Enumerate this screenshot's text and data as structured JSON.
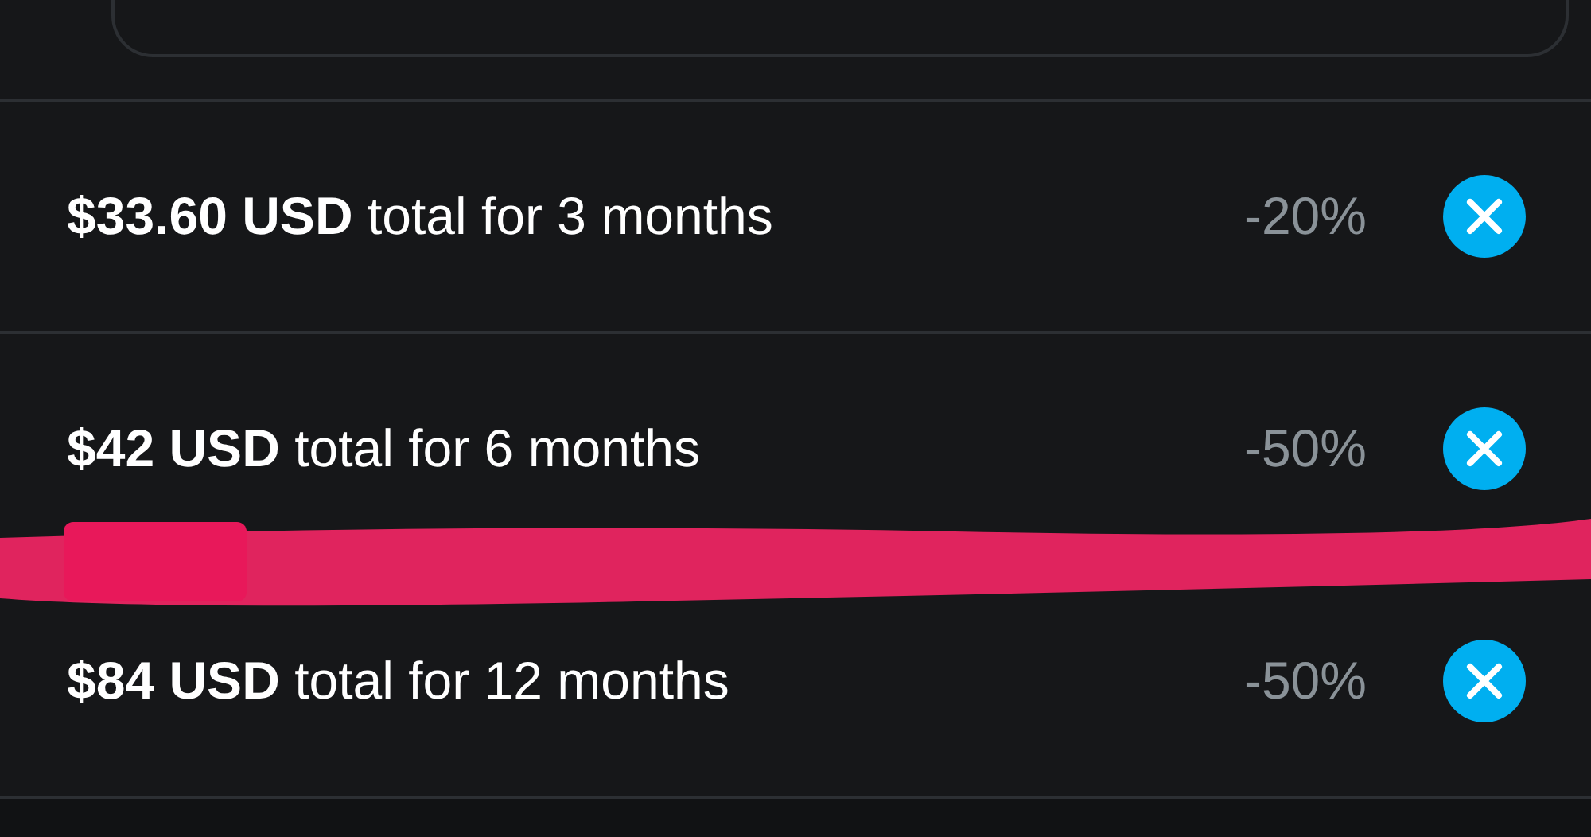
{
  "bundles": [
    {
      "price": "**$33.60 USD** total for 3 months",
      "discount": "-20%"
    },
    {
      "price": "**$42 USD** total for 6 months",
      "discount": "-50%"
    },
    {
      "price": "**$84 USD** total for 12 months",
      "discount": "-50%"
    }
  ],
  "annotation": {
    "kind": "scribble"
  }
}
